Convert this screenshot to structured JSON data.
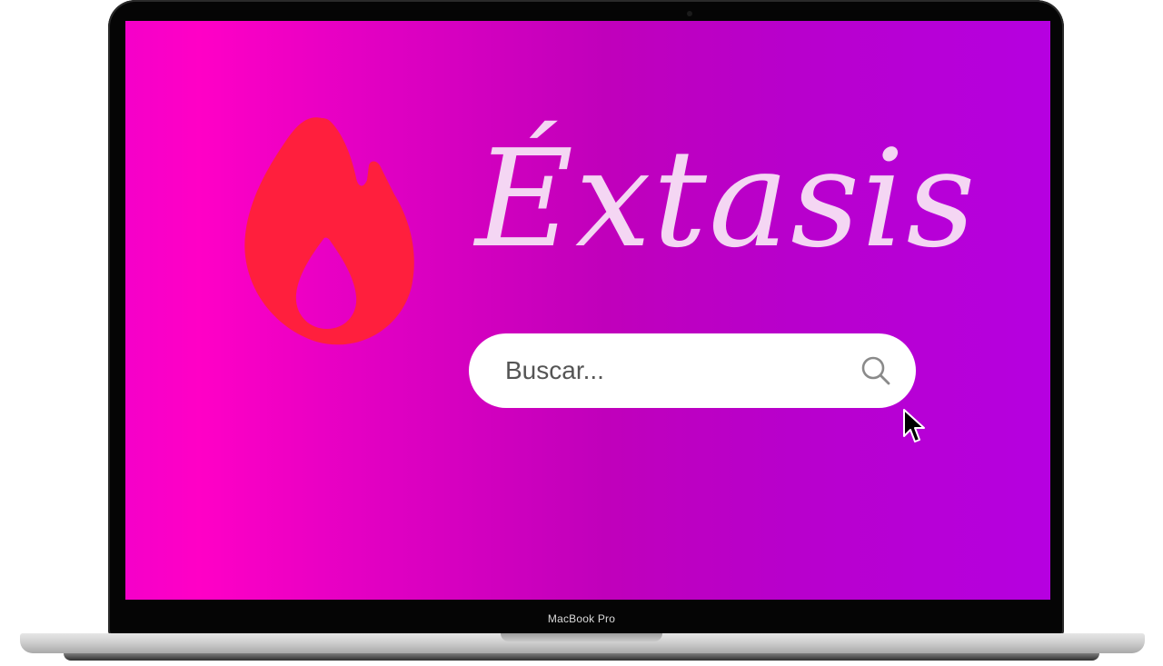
{
  "device": {
    "label": "MacBook Pro"
  },
  "site": {
    "brand_name": "Éxtasis",
    "logo_icon": "flame-icon",
    "colors": {
      "flame": "#ff1f3d",
      "brand_text": "#f4d6f3",
      "gradient_left": "#ff00c6",
      "gradient_right": "#b600e0"
    }
  },
  "search": {
    "placeholder": "Buscar...",
    "value": "",
    "icon": "search-icon"
  }
}
